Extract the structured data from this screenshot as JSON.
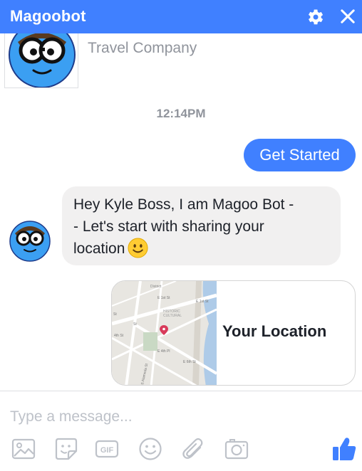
{
  "header": {
    "title": "Magoobot",
    "settings_icon": "gear-icon",
    "close_icon": "close-icon",
    "color": "#4080ff"
  },
  "profile": {
    "subtitle": "Travel Company"
  },
  "conversation": {
    "timestamp": "12:14PM",
    "outgoing": "Get Started",
    "incoming_lines": [
      "Hey Kyle Boss, I am Magoo Bot -",
      "- Let's start with sharing your",
      "location"
    ],
    "location_card": {
      "title": "Your Location",
      "map_labels": {
        "district": "District",
        "historic": "HISTORIC",
        "cultural": "CULTURAL",
        "street_1": "E 1st St",
        "street_2": "E 1st St",
        "street_3": "4th St",
        "street_4": "E 4th Pl",
        "street_5": "E 6th St",
        "street_6": "S Alameda St",
        "street_7": "St",
        "street_8": "St"
      }
    }
  },
  "composer": {
    "placeholder": "Type a message...",
    "gif_label": "GIF",
    "tools": [
      "image-icon",
      "sticker-icon",
      "gif-icon",
      "emoji-icon",
      "attachment-icon",
      "camera-icon",
      "thumbs-up-icon"
    ]
  }
}
